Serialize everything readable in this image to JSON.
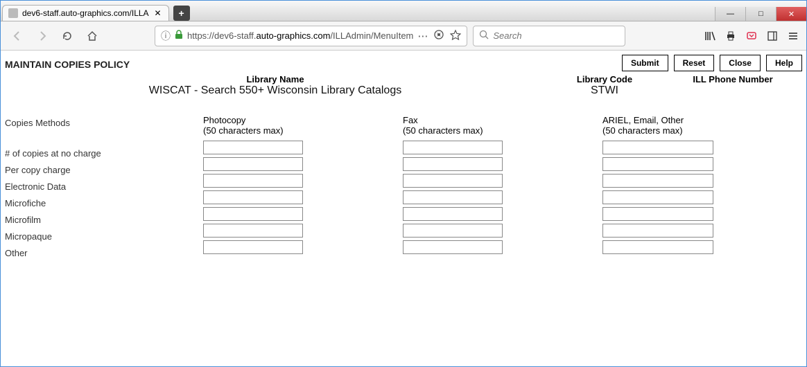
{
  "window": {
    "tab_title": "dev6-staff.auto-graphics.com/ILLA",
    "minimize": "—",
    "maximize": "□",
    "close": "✕",
    "newtab": "+",
    "tab_close": "✕"
  },
  "toolbar": {
    "url_prefix": "https://dev6-staff.",
    "url_domain": "auto-graphics.com",
    "url_suffix": "/ILLAdmin/MenuItem",
    "search_placeholder": "Search",
    "ellipsis": "⋯"
  },
  "page": {
    "title": "MAINTAIN COPIES POLICY",
    "buttons": {
      "submit": "Submit",
      "reset": "Reset",
      "close": "Close",
      "help": "Help"
    },
    "header": {
      "libname_label": "Library Name",
      "libcode_label": "Library Code",
      "illphone_label": "ILL Phone Number",
      "libname_value": "WISCAT - Search 550+ Wisconsin Library Catalogs",
      "libcode_value": "STWI",
      "illphone_value": ""
    }
  },
  "form": {
    "row_header": "Copies Methods",
    "rows": [
      "# of copies at no charge",
      "Per copy charge",
      "Electronic Data",
      "Microfiche",
      "Microfilm",
      "Micropaque",
      "Other"
    ],
    "hint": "(50 characters max)",
    "columns": {
      "photocopy": {
        "label": "Photocopy",
        "values": [
          "",
          "",
          "",
          "",
          "",
          "",
          "",
          ""
        ]
      },
      "fax": {
        "label": "Fax",
        "values": [
          "",
          "",
          "",
          "",
          "",
          "",
          "",
          ""
        ]
      },
      "ariel": {
        "label": "ARIEL, Email, Other",
        "values": [
          "",
          "",
          "",
          "",
          "",
          "",
          "",
          ""
        ]
      }
    }
  }
}
